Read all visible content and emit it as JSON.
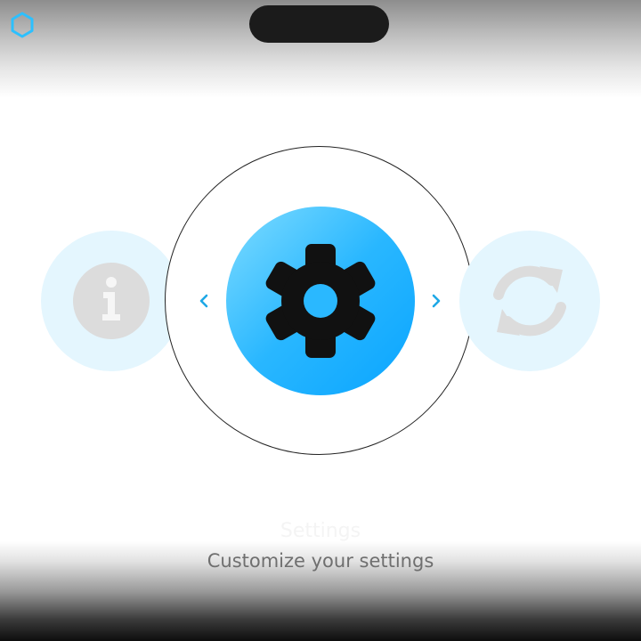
{
  "carousel": {
    "items": [
      {
        "name": "info",
        "icon": "info-icon"
      },
      {
        "name": "settings",
        "icon": "gear-icon",
        "selected": true
      },
      {
        "name": "sync",
        "icon": "sync-icon"
      }
    ],
    "prev_icon": "chevron-left-icon",
    "next_icon": "chevron-right-icon"
  },
  "caption": {
    "title": "Settings",
    "subtitle": "Customize your settings"
  },
  "colors": {
    "accent": "#0aa5ff",
    "accent_light": "#7fdcff",
    "side_bg": "#e4f6fe",
    "icon_dark": "#111111",
    "icon_muted": "#dcdcdc",
    "brand": "#2cc0ff"
  }
}
